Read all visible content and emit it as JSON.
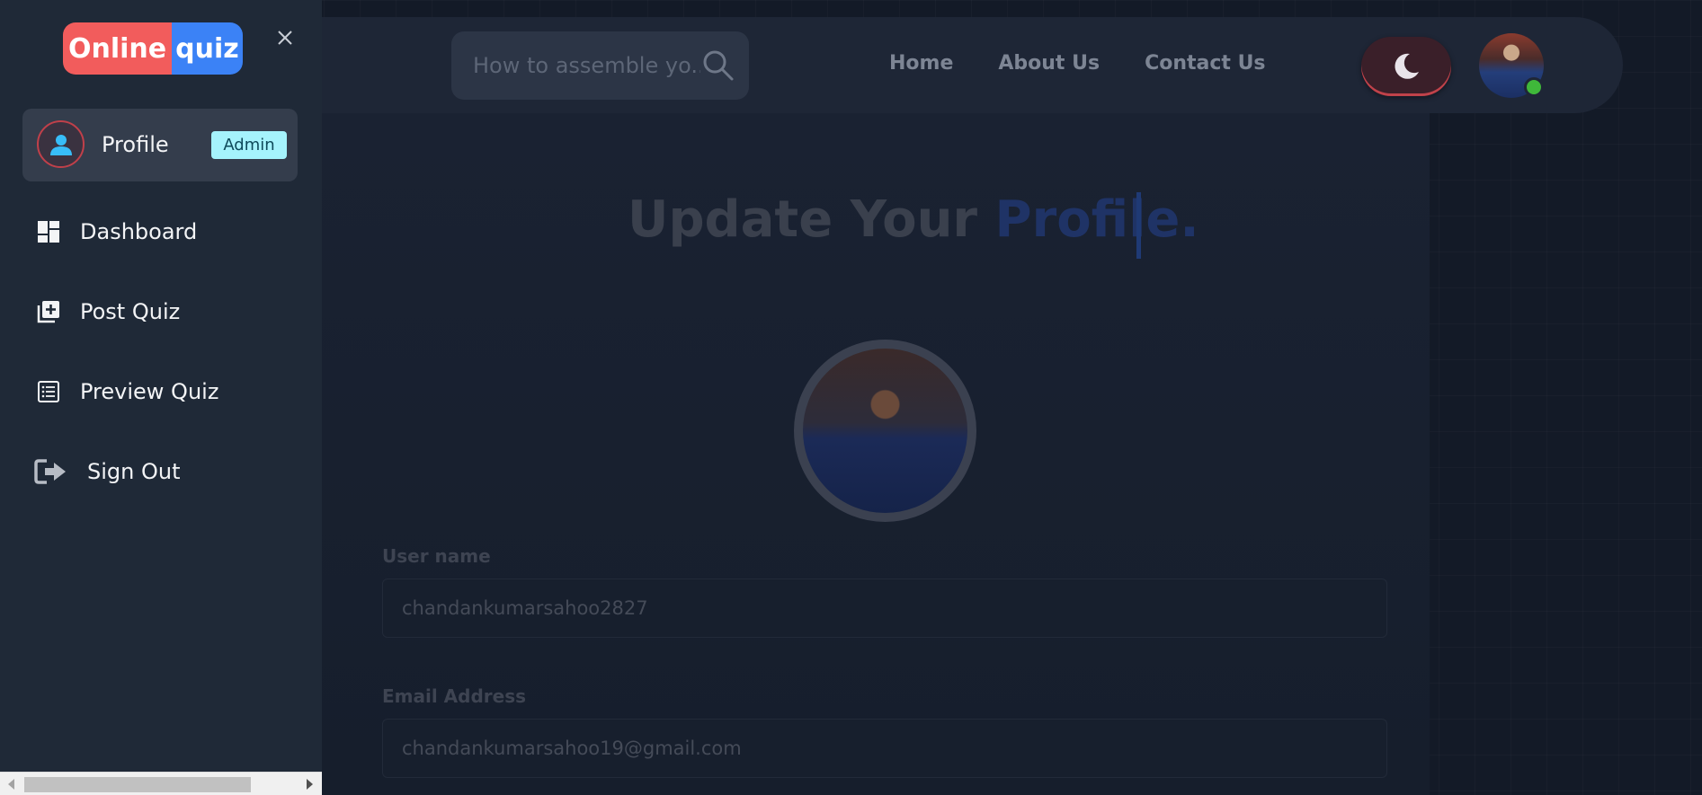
{
  "sidebar": {
    "logo": {
      "part1": "Online",
      "part2": "quiz"
    },
    "close_label": "×",
    "profile": {
      "label": "Profile",
      "badge": "Admin"
    },
    "items": [
      {
        "label": "Dashboard",
        "icon": "dashboard-icon"
      },
      {
        "label": "Post Quiz",
        "icon": "post-quiz-icon"
      },
      {
        "label": "Preview Quiz",
        "icon": "preview-quiz-icon"
      },
      {
        "label": "Sign Out",
        "icon": "sign-out-icon"
      }
    ]
  },
  "header": {
    "search_placeholder": "How to assemble yo...",
    "nav": [
      "Home",
      "About Us",
      "Contact Us"
    ],
    "theme": "dark"
  },
  "main": {
    "heading_prefix": "Update Your ",
    "heading_accent": "Profile.",
    "fields": [
      {
        "label": "User name",
        "value": "chandankumarsahoo2827"
      },
      {
        "label": "Email Address",
        "value": "chandankumarsahoo19@gmail.com"
      }
    ]
  },
  "colors": {
    "logo_red": "#f25c5c",
    "logo_blue": "#3b82f6",
    "admin_badge": "#a5f3fc",
    "online": "#3fb83a"
  }
}
